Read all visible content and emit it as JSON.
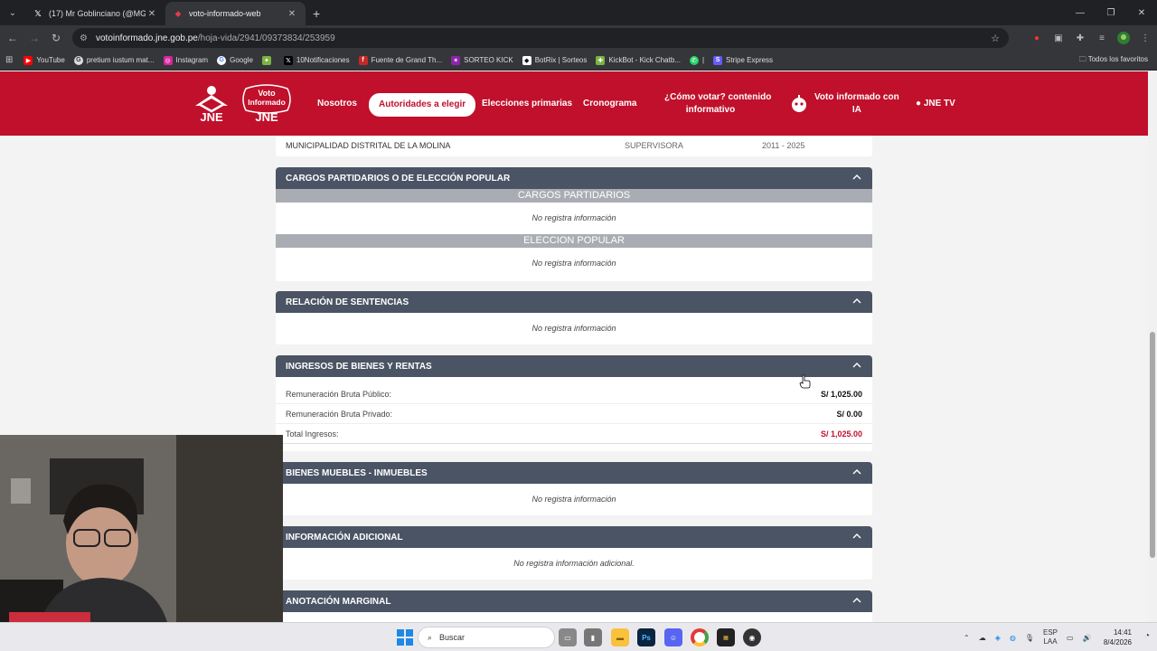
{
  "browser": {
    "tabs": [
      {
        "title": "(17) Mr Goblinciano (@MGoblin",
        "icon": "x-logo-icon"
      },
      {
        "title": "voto-informado-web",
        "icon": "jne-favicon-icon"
      }
    ],
    "url_host": "votoinformado.jne.gob.pe",
    "url_path": "/hoja-vida/2941/09373834/253959",
    "bookmarks": [
      "YouTube",
      "pretium iustum mat...",
      "Instagram",
      "Google",
      "",
      "10Notificaciones",
      "Fuente de Grand Th...",
      "SORTEO KICK",
      "BotRix | Sorteos",
      "KickBot - Kick Chatb...",
      "|",
      "Stripe Express"
    ],
    "all_bookmarks": "Todos los favoritos"
  },
  "site": {
    "nav": {
      "nosotros": "Nosotros",
      "autoridades": "Autoridades a elegir",
      "primarias": "Elecciones primarias",
      "cronograma": "Cronograma",
      "como_votar_1": "¿Cómo votar? contenido",
      "como_votar_2": "informativo",
      "vi_ia_1": "Voto informado con",
      "vi_ia_2": "IA",
      "jne_tv": "● JNE TV"
    },
    "logo_text": {
      "jne": "JNE",
      "voto": "Voto",
      "informado": "Informado"
    }
  },
  "experience_row": {
    "entity": "MUNICIPALIDAD DISTRITAL DE LA MOLINA",
    "role": "SUPERVISORA",
    "period": "2011 - 2025"
  },
  "sections": {
    "cargos": {
      "title": "CARGOS PARTIDARIOS O DE ELECCIÓN POPULAR",
      "sub1": "CARGOS PARTIDARIOS",
      "sub1_empty": "No registra información",
      "sub2": "ELECCION POPULAR",
      "sub2_empty": "No registra información"
    },
    "sentencias": {
      "title": "RELACIÓN DE SENTENCIAS",
      "empty": "No registra información"
    },
    "ingresos": {
      "title": "INGRESOS DE BIENES Y RENTAS",
      "rows": [
        {
          "label": "Remuneración Bruta Público:",
          "value": "S/ 1,025.00"
        },
        {
          "label": "Remuneración Bruta Privado:",
          "value": "S/ 0.00"
        },
        {
          "label": "Total Ingresos:",
          "value": "S/ 1,025.00"
        }
      ]
    },
    "bienes": {
      "title": "BIENES MUEBLES - INMUEBLES",
      "empty": "No registra información"
    },
    "adicional": {
      "title": "INFORMACIÓN ADICIONAL",
      "empty": "No registra información adicional."
    },
    "anotacion": {
      "title": "ANOTACIÓN MARGINAL"
    }
  },
  "taskbar": {
    "search": "Buscar",
    "lang1": "ESP",
    "lang2": "LAA",
    "time": "14:41",
    "date": "8/4/2026"
  },
  "colors": {
    "brand_red": "#c0102b",
    "section_head": "#4b5464",
    "subhead": "#a9adb3"
  }
}
